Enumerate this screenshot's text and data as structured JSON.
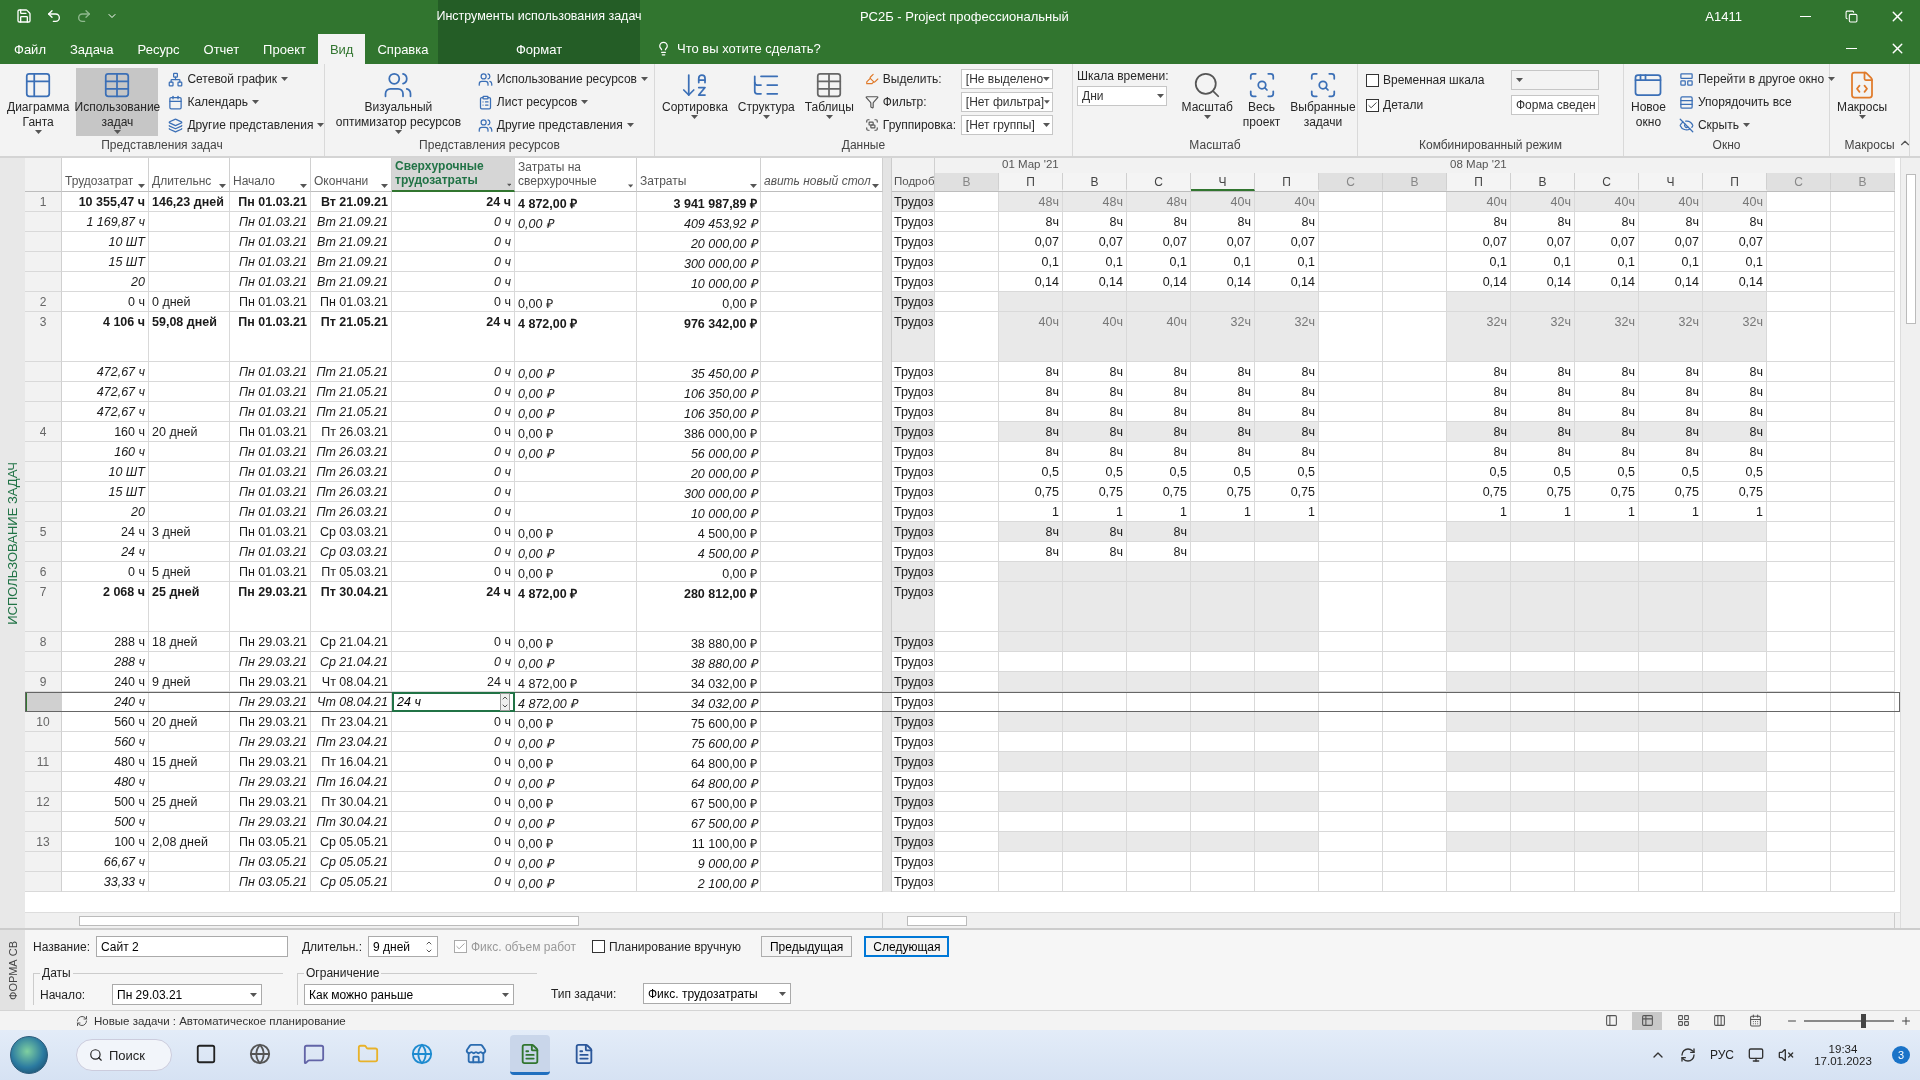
{
  "title_bar": {
    "context_title": "Инструменты использования задач",
    "title": "РС2Б  -  Project профессиональный",
    "user": "A1411"
  },
  "tabs": [
    {
      "label": "Файл",
      "selected": false
    },
    {
      "label": "Задача",
      "selected": false
    },
    {
      "label": "Ресурс",
      "selected": false
    },
    {
      "label": "Отчет",
      "selected": false
    },
    {
      "label": "Проект",
      "selected": false
    },
    {
      "label": "Вид",
      "selected": true
    },
    {
      "label": "Справка",
      "selected": false
    }
  ],
  "context_tab": {
    "label": "Формат",
    "selected": false
  },
  "tell_me": "Что вы хотите сделать?",
  "ribbon": {
    "groups": [
      {
        "label": "Представления задач",
        "items": [
          {
            "kind": "large",
            "label": "Диаграмма Ганта",
            "dropdown": true,
            "selected": false
          },
          {
            "kind": "large",
            "label": "Использование задач",
            "dropdown": true,
            "selected": true
          },
          {
            "kind": "stack",
            "items": [
              {
                "kind": "small",
                "label": "Сетевой график",
                "dropdown": true
              },
              {
                "kind": "small",
                "label": "Календарь",
                "dropdown": true
              },
              {
                "kind": "small",
                "label": "Другие представления",
                "dropdown": true
              }
            ]
          }
        ]
      },
      {
        "label": "Представления ресурсов",
        "items": [
          {
            "kind": "large",
            "label": "Визуальный оптимизатор ресурсов",
            "dropdown": true,
            "selected": false
          },
          {
            "kind": "stack",
            "items": [
              {
                "kind": "small",
                "label": "Использование ресурсов",
                "dropdown": true
              },
              {
                "kind": "small",
                "label": "Лист ресурсов",
                "dropdown": true
              },
              {
                "kind": "small",
                "label": "Другие представления",
                "dropdown": true
              }
            ]
          }
        ]
      },
      {
        "label": "Данные",
        "items": [
          {
            "kind": "large",
            "label": "Сортировка",
            "dropdown": true,
            "selected": false
          },
          {
            "kind": "large",
            "label": "Структура",
            "dropdown": true,
            "selected": false
          },
          {
            "kind": "large",
            "label": "Таблицы",
            "dropdown": true,
            "selected": false
          },
          {
            "kind": "stack",
            "items": [
              {
                "kind": "select",
                "label": "Выделить:",
                "value": "[Не выделено"
              },
              {
                "kind": "select",
                "label": "Фильтр:",
                "value": "[Нет фильтра]"
              },
              {
                "kind": "select",
                "label": "Группировка:",
                "value": "[Нет группы]"
              }
            ]
          }
        ]
      },
      {
        "label": "Масштаб",
        "items": [
          {
            "kind": "labeled_select",
            "label": "Шкала времени:",
            "value": "Дни"
          },
          {
            "kind": "large",
            "label": "Масштаб",
            "dropdown": true,
            "selected": false
          },
          {
            "kind": "large",
            "label": "Весь проект",
            "dropdown": false,
            "selected": false
          },
          {
            "kind": "large",
            "label": "Выбранные задачи",
            "dropdown": false,
            "selected": false
          }
        ]
      },
      {
        "label": "Комбинированный режим",
        "items": [
          {
            "kind": "stack",
            "items": [
              {
                "kind": "check",
                "label": "Временная шкала",
                "checked": false,
                "disabled": true
              },
              {
                "kind": "check",
                "label": "Детали",
                "checked": true,
                "disabled": false,
                "value": "Форма сведен"
              }
            ]
          }
        ]
      },
      {
        "label": "Окно",
        "items": [
          {
            "kind": "large",
            "label": "Новое окно",
            "dropdown": false,
            "selected": false
          },
          {
            "kind": "stack",
            "items": [
              {
                "kind": "small",
                "label": "Перейти в другое окно",
                "dropdown": true
              },
              {
                "kind": "small",
                "label": "Упорядочить все",
                "dropdown": false
              },
              {
                "kind": "small",
                "label": "Скрыть",
                "dropdown": true
              }
            ]
          }
        ]
      },
      {
        "label": "Макросы",
        "items": [
          {
            "kind": "large",
            "label": "Макросы",
            "dropdown": true,
            "selected": false
          }
        ]
      }
    ]
  },
  "side_label": "ИСПОЛЬЗОВАНИЕ ЗАДАЧ",
  "table": {
    "columns": [
      {
        "label": "Трудозатрат",
        "kind": "data",
        "selected": false
      },
      {
        "label": "Длительнс",
        "kind": "data",
        "selected": false
      },
      {
        "label": "Начало",
        "kind": "data",
        "selected": false
      },
      {
        "label": "Окончани",
        "kind": "data",
        "selected": false
      },
      {
        "label": "Сверхурочные трудозатраты",
        "kind": "data",
        "selected": true
      },
      {
        "label": "Затраты на сверхурочные",
        "kind": "data",
        "selected": false
      },
      {
        "label": "Затраты",
        "kind": "data",
        "selected": false
      },
      {
        "label": "авить новый стол",
        "kind": "add",
        "selected": false
      }
    ],
    "rows": [
      {
        "id": "1",
        "kind": "summary",
        "selected": false,
        "work": "10 355,47 ч",
        "duration": "146,23 дней",
        "start": "Пн 01.03.21",
        "finish": "Вт 21.09.21",
        "overtime": "24 ч",
        "overtime_cost": "4 872,00 ₽",
        "cost": "3 941 987,89 ₽",
        "detail": "Трудоз",
        "days": [
          "48ч",
          "48ч",
          "48ч",
          "40ч",
          "40ч",
          "40ч",
          "40ч",
          "40ч",
          "40ч",
          "40ч"
        ]
      },
      {
        "kind": "assignment",
        "selected": false,
        "work": "1 169,87 ч",
        "start": "Пн 01.03.21",
        "finish": "Вт 21.09.21",
        "overtime": "0 ч",
        "overtime_cost": "0,00 ₽",
        "cost": "409 453,92 ₽",
        "detail": "Трудоз",
        "days": [
          "8ч",
          "8ч",
          "8ч",
          "8ч",
          "8ч",
          "8ч",
          "8ч",
          "8ч",
          "8ч",
          "8ч"
        ]
      },
      {
        "kind": "assignment",
        "selected": false,
        "work": "10 ШТ",
        "start": "Пн 01.03.21",
        "finish": "Вт 21.09.21",
        "overtime": "0 ч",
        "cost": "20 000,00 ₽",
        "detail": "Трудоз",
        "days": [
          "0,07",
          "0,07",
          "0,07",
          "0,07",
          "0,07",
          "0,07",
          "0,07",
          "0,07",
          "0,07",
          "0,07"
        ]
      },
      {
        "kind": "assignment",
        "selected": false,
        "work": "15 ШТ",
        "start": "Пн 01.03.21",
        "finish": "Вт 21.09.21",
        "overtime": "0 ч",
        "cost": "300 000,00 ₽",
        "detail": "Трудоз",
        "days": [
          "0,1",
          "0,1",
          "0,1",
          "0,1",
          "0,1",
          "0,1",
          "0,1",
          "0,1",
          "0,1",
          "0,1"
        ]
      },
      {
        "kind": "assignment",
        "selected": false,
        "work": "20",
        "start": "Пн 01.03.21",
        "finish": "Вт 21.09.21",
        "overtime": "0 ч",
        "cost": "10 000,00 ₽",
        "detail": "Трудоз",
        "days": [
          "0,14",
          "0,14",
          "0,14",
          "0,14",
          "0,14",
          "0,14",
          "0,14",
          "0,14",
          "0,14",
          "0,14"
        ]
      },
      {
        "id": "2",
        "kind": "task",
        "selected": false,
        "work": "0 ч",
        "duration": "0 дней",
        "start": "Пн 01.03.21",
        "finish": "Пн 01.03.21",
        "overtime": "0 ч",
        "overtime_cost": "0,00 ₽",
        "cost": "0,00 ₽",
        "detail": "Трудоз"
      },
      {
        "id": "3",
        "kind": "summary",
        "tall": true,
        "selected": false,
        "work": "4 106 ч",
        "duration": "59,08 дней",
        "start": "Пн 01.03.21",
        "finish": "Пт 21.05.21",
        "overtime": "24 ч",
        "overtime_cost": "4 872,00 ₽",
        "cost": "976 342,00 ₽",
        "detail": "Трудоз",
        "days": [
          "40ч",
          "40ч",
          "40ч",
          "32ч",
          "32ч",
          "32ч",
          "32ч",
          "32ч",
          "32ч",
          "32ч"
        ]
      },
      {
        "kind": "assignment",
        "selected": false,
        "work": "472,67 ч",
        "start": "Пн 01.03.21",
        "finish": "Пт 21.05.21",
        "overtime": "0 ч",
        "overtime_cost": "0,00 ₽",
        "cost": "35 450,00 ₽",
        "detail": "Трудоз",
        "days": [
          "8ч",
          "8ч",
          "8ч",
          "8ч",
          "8ч",
          "8ч",
          "8ч",
          "8ч",
          "8ч",
          "8ч"
        ]
      },
      {
        "kind": "assignment",
        "selected": false,
        "work": "472,67 ч",
        "start": "Пн 01.03.21",
        "finish": "Пт 21.05.21",
        "overtime": "0 ч",
        "overtime_cost": "0,00 ₽",
        "cost": "106 350,00 ₽",
        "detail": "Трудоз",
        "days": [
          "8ч",
          "8ч",
          "8ч",
          "8ч",
          "8ч",
          "8ч",
          "8ч",
          "8ч",
          "8ч",
          "8ч"
        ]
      },
      {
        "kind": "assignment",
        "selected": false,
        "work": "472,67 ч",
        "start": "Пн 01.03.21",
        "finish": "Пт 21.05.21",
        "overtime": "0 ч",
        "overtime_cost": "0,00 ₽",
        "cost": "106 350,00 ₽",
        "detail": "Трудоз",
        "days": [
          "8ч",
          "8ч",
          "8ч",
          "8ч",
          "8ч",
          "8ч",
          "8ч",
          "8ч",
          "8ч",
          "8ч"
        ]
      },
      {
        "id": "4",
        "kind": "task",
        "selected": false,
        "work": "160 ч",
        "duration": "20 дней",
        "start": "Пн 01.03.21",
        "finish": "Пт 26.03.21",
        "overtime": "0 ч",
        "overtime_cost": "0,00 ₽",
        "cost": "386 000,00 ₽",
        "detail": "Трудоз",
        "days": [
          "8ч",
          "8ч",
          "8ч",
          "8ч",
          "8ч",
          "8ч",
          "8ч",
          "8ч",
          "8ч",
          "8ч"
        ]
      },
      {
        "kind": "assignment",
        "selected": false,
        "work": "160 ч",
        "start": "Пн 01.03.21",
        "finish": "Пт 26.03.21",
        "overtime": "0 ч",
        "overtime_cost": "0,00 ₽",
        "cost": "56 000,00 ₽",
        "detail": "Трудоз",
        "days": [
          "8ч",
          "8ч",
          "8ч",
          "8ч",
          "8ч",
          "8ч",
          "8ч",
          "8ч",
          "8ч",
          "8ч"
        ]
      },
      {
        "kind": "assignment",
        "selected": false,
        "work": "10 ШТ",
        "start": "Пн 01.03.21",
        "finish": "Пт 26.03.21",
        "overtime": "0 ч",
        "cost": "20 000,00 ₽",
        "detail": "Трудоз",
        "days": [
          "0,5",
          "0,5",
          "0,5",
          "0,5",
          "0,5",
          "0,5",
          "0,5",
          "0,5",
          "0,5",
          "0,5"
        ]
      },
      {
        "kind": "assignment",
        "selected": false,
        "work": "15 ШТ",
        "start": "Пн 01.03.21",
        "finish": "Пт 26.03.21",
        "overtime": "0 ч",
        "cost": "300 000,00 ₽",
        "detail": "Трудоз",
        "days": [
          "0,75",
          "0,75",
          "0,75",
          "0,75",
          "0,75",
          "0,75",
          "0,75",
          "0,75",
          "0,75",
          "0,75"
        ]
      },
      {
        "kind": "assignment",
        "selected": false,
        "work": "20",
        "start": "Пн 01.03.21",
        "finish": "Пт 26.03.21",
        "overtime": "0 ч",
        "cost": "10 000,00 ₽",
        "detail": "Трудоз",
        "days": [
          "1",
          "1",
          "1",
          "1",
          "1",
          "1",
          "1",
          "1",
          "1",
          "1"
        ]
      },
      {
        "id": "5",
        "kind": "task",
        "selected": false,
        "work": "24 ч",
        "duration": "3 дней",
        "start": "Пн 01.03.21",
        "finish": "Ср 03.03.21",
        "overtime": "0 ч",
        "overtime_cost": "0,00 ₽",
        "cost": "4 500,00 ₽",
        "detail": "Трудоз",
        "days": [
          "8ч",
          "8ч",
          "8ч"
        ]
      },
      {
        "kind": "assignment",
        "selected": false,
        "work": "24 ч",
        "start": "Пн 01.03.21",
        "finish": "Ср 03.03.21",
        "overtime": "0 ч",
        "overtime_cost": "0,00 ₽",
        "cost": "4 500,00 ₽",
        "detail": "Трудоз",
        "days": [
          "8ч",
          "8ч",
          "8ч"
        ]
      },
      {
        "id": "6",
        "kind": "task",
        "selected": false,
        "work": "0 ч",
        "duration": "5 дней",
        "start": "Пн 01.03.21",
        "finish": "Пт 05.03.21",
        "overtime": "0 ч",
        "overtime_cost": "0,00 ₽",
        "cost": "0,00 ₽",
        "detail": "Трудоз"
      },
      {
        "id": "7",
        "kind": "summary",
        "tall": true,
        "selected": false,
        "work": "2 068 ч",
        "duration": "25 дней",
        "start": "Пн 29.03.21",
        "finish": "Пт 30.04.21",
        "overtime": "24 ч",
        "overtime_cost": "4 872,00 ₽",
        "cost": "280 812,00 ₽",
        "detail": "Трудоз"
      },
      {
        "id": "8",
        "kind": "task",
        "selected": false,
        "work": "288 ч",
        "duration": "18 дней",
        "start": "Пн 29.03.21",
        "finish": "Ср 21.04.21",
        "overtime": "0 ч",
        "overtime_cost": "0,00 ₽",
        "cost": "38 880,00 ₽",
        "detail": "Трудоз"
      },
      {
        "kind": "assignment",
        "selected": false,
        "work": "288 ч",
        "start": "Пн 29.03.21",
        "finish": "Ср 21.04.21",
        "overtime": "0 ч",
        "overtime_cost": "0,00 ₽",
        "cost": "38 880,00 ₽",
        "detail": "Трудоз"
      },
      {
        "id": "9",
        "kind": "task",
        "selected": false,
        "work": "240 ч",
        "duration": "9 дней",
        "start": "Пн 29.03.21",
        "finish": "Чт 08.04.21",
        "overtime": "24 ч",
        "overtime_cost": "4 872,00 ₽",
        "cost": "34 032,00 ₽",
        "detail": "Трудоз"
      },
      {
        "kind": "assignment",
        "selected": true,
        "work": "240 ч",
        "start": "Пн 29.03.21",
        "finish": "Чт 08.04.21",
        "overtime": "24 ч",
        "overtime_cost": "4 872,00 ₽",
        "cost": "34 032,00 ₽",
        "detail": "Трудоз"
      },
      {
        "id": "10",
        "kind": "task",
        "selected": false,
        "work": "560 ч",
        "duration": "20 дней",
        "start": "Пн 29.03.21",
        "finish": "Пт 23.04.21",
        "overtime": "0 ч",
        "overtime_cost": "0,00 ₽",
        "cost": "75 600,00 ₽",
        "detail": "Трудоз"
      },
      {
        "kind": "assignment",
        "selected": false,
        "work": "560 ч",
        "start": "Пн 29.03.21",
        "finish": "Пт 23.04.21",
        "overtime": "0 ч",
        "overtime_cost": "0,00 ₽",
        "cost": "75 600,00 ₽",
        "detail": "Трудоз"
      },
      {
        "id": "11",
        "kind": "task",
        "selected": false,
        "work": "480 ч",
        "duration": "15 дней",
        "start": "Пн 29.03.21",
        "finish": "Пт 16.04.21",
        "overtime": "0 ч",
        "overtime_cost": "0,00 ₽",
        "cost": "64 800,00 ₽",
        "detail": "Трудоз"
      },
      {
        "kind": "assignment",
        "selected": false,
        "work": "480 ч",
        "start": "Пн 29.03.21",
        "finish": "Пт 16.04.21",
        "overtime": "0 ч",
        "overtime_cost": "0,00 ₽",
        "cost": "64 800,00 ₽",
        "detail": "Трудоз"
      },
      {
        "id": "12",
        "kind": "task",
        "selected": false,
        "work": "500 ч",
        "duration": "25 дней",
        "start": "Пн 29.03.21",
        "finish": "Пт 30.04.21",
        "overtime": "0 ч",
        "overtime_cost": "0,00 ₽",
        "cost": "67 500,00 ₽",
        "detail": "Трудоз"
      },
      {
        "kind": "assignment",
        "selected": false,
        "work": "500 ч",
        "start": "Пн 29.03.21",
        "finish": "Пт 30.04.21",
        "overtime": "0 ч",
        "overtime_cost": "0,00 ₽",
        "cost": "67 500,00 ₽",
        "detail": "Трудоз"
      },
      {
        "id": "13",
        "kind": "task",
        "selected": false,
        "work": "100 ч",
        "duration": "2,08 дней",
        "start": "Пн 03.05.21",
        "finish": "Ср 05.05.21",
        "overtime": "0 ч",
        "overtime_cost": "0,00 ₽",
        "cost": "11 100,00 ₽",
        "detail": "Трудоз"
      },
      {
        "kind": "assignment",
        "selected": false,
        "work": "66,67 ч",
        "start": "Пн 03.05.21",
        "finish": "Ср 05.05.21",
        "overtime": "0 ч",
        "overtime_cost": "0,00 ₽",
        "cost": "9 000,00 ₽",
        "detail": "Трудоз"
      },
      {
        "kind": "assignment",
        "selected": false,
        "work": "33,33 ч",
        "start": "Пн 03.05.21",
        "finish": "Ср 05.05.21",
        "overtime": "0 ч",
        "overtime_cost": "0,00 ₽",
        "cost": "2 100,00 ₽",
        "detail": "Трудоз"
      }
    ]
  },
  "timeline": {
    "detail_header": "Подроб",
    "weeks": [
      {
        "label": "01 Мар '21"
      },
      {
        "label": "08 Мар '21"
      }
    ],
    "days": [
      {
        "label": "В",
        "weekend": true,
        "selected": false
      },
      {
        "label": "П",
        "weekend": false,
        "selected": false
      },
      {
        "label": "В",
        "weekend": false,
        "selected": false
      },
      {
        "label": "С",
        "weekend": false,
        "selected": false
      },
      {
        "label": "Ч",
        "weekend": false,
        "selected": true
      },
      {
        "label": "П",
        "weekend": false,
        "selected": false
      },
      {
        "label": "С",
        "weekend": true,
        "selected": false
      },
      {
        "label": "В",
        "weekend": true,
        "selected": false
      },
      {
        "label": "П",
        "weekend": false,
        "selected": false
      },
      {
        "label": "В",
        "weekend": false,
        "selected": false
      },
      {
        "label": "С",
        "weekend": false,
        "selected": false
      },
      {
        "label": "Ч",
        "weekend": false,
        "selected": false
      },
      {
        "label": "П",
        "weekend": false,
        "selected": false
      },
      {
        "label": "С",
        "weekend": true,
        "selected": false
      },
      {
        "label": "В",
        "weekend": true,
        "selected": false
      }
    ]
  },
  "form": {
    "side_label": "ФОРМА СВ",
    "name_label": "Название:",
    "name": "Сайт 2",
    "duration_label": "Длительн.:",
    "duration": "9 дней",
    "fixed_work": {
      "label": "Фикс. объем работ",
      "checked": true,
      "disabled": true
    },
    "manual": {
      "label": "Планирование вручную",
      "checked": false,
      "disabled": false
    },
    "buttons": [
      {
        "label": "Предыдущая",
        "focused": false
      },
      {
        "label": "Следующая",
        "focused": true
      }
    ],
    "dates_label": "Даты",
    "start_label": "Начало:",
    "start": "Пн 29.03.21",
    "constraint_label": "Ограничение",
    "constraint": "Как можно раньше",
    "type_label": "Тип задачи:",
    "type": "Фикс. трудозатраты"
  },
  "status_bar": {
    "text": "Новые задачи : Автоматическое планирование",
    "views": [
      {
        "selected": false
      },
      {
        "selected": true
      },
      {
        "selected": false
      },
      {
        "selected": false
      },
      {
        "selected": false
      }
    ],
    "zoom": {
      "level": 0.66
    }
  },
  "taskbar": {
    "search": "Поиск",
    "apps": [
      {
        "selected": false
      },
      {
        "selected": false
      },
      {
        "selected": false
      },
      {
        "selected": false
      },
      {
        "selected": false
      },
      {
        "selected": false
      },
      {
        "selected": true
      },
      {
        "selected": false
      }
    ],
    "lang": "РУС",
    "time": "19:34",
    "date": "17.01.2023",
    "badge": "3"
  }
}
